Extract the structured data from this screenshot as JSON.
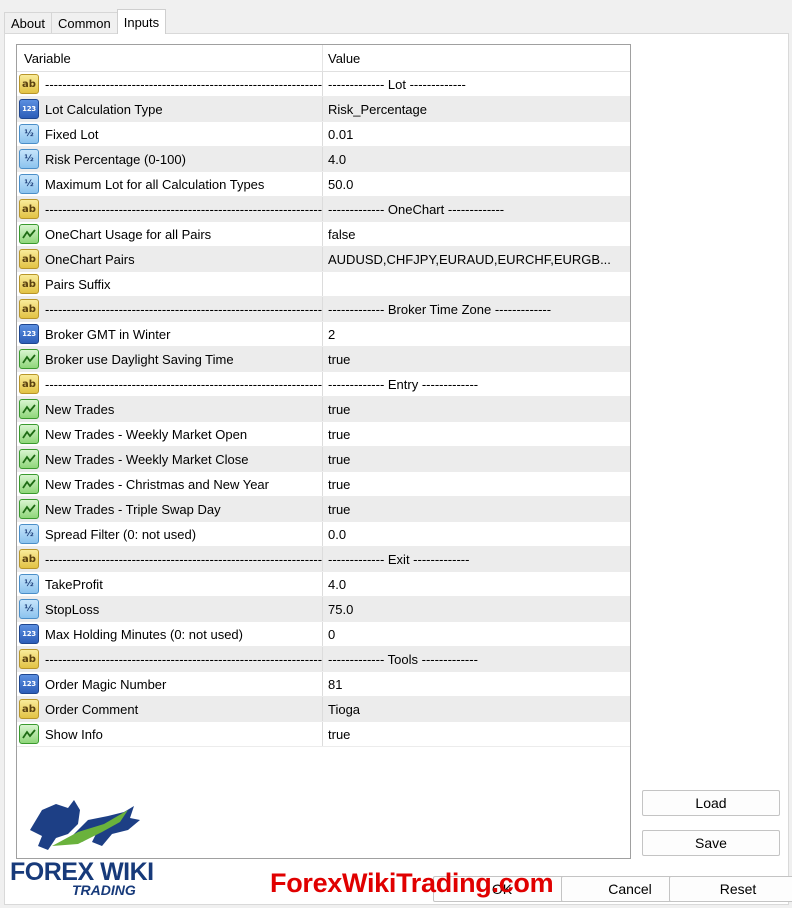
{
  "tabs": [
    {
      "label": "About"
    },
    {
      "label": "Common"
    },
    {
      "label": "Inputs"
    }
  ],
  "grid": {
    "headers": {
      "variable": "Variable",
      "value": "Value"
    },
    "rows": [
      {
        "icon": "ab",
        "variable": "-----------------------------------------------------------------",
        "value": "------------- Lot -------------"
      },
      {
        "icon": "123",
        "variable": "Lot Calculation Type",
        "value": "Risk_Percentage"
      },
      {
        "icon": "half",
        "variable": "Fixed Lot",
        "value": "0.01"
      },
      {
        "icon": "half",
        "variable": "Risk Percentage (0-100)",
        "value": "4.0"
      },
      {
        "icon": "half",
        "variable": "Maximum Lot for all Calculation Types",
        "value": "50.0"
      },
      {
        "icon": "ab",
        "variable": "-----------------------------------------------------------------",
        "value": "------------- OneChart -------------"
      },
      {
        "icon": "bool",
        "variable": "OneChart Usage for all Pairs",
        "value": "false"
      },
      {
        "icon": "ab",
        "variable": "OneChart Pairs",
        "value": "AUDUSD,CHFJPY,EURAUD,EURCHF,EURGB..."
      },
      {
        "icon": "ab",
        "variable": "Pairs Suffix",
        "value": ""
      },
      {
        "icon": "ab",
        "variable": "-----------------------------------------------------------------",
        "value": "------------- Broker Time Zone -------------"
      },
      {
        "icon": "123",
        "variable": "Broker GMT in Winter",
        "value": "2"
      },
      {
        "icon": "bool",
        "variable": "Broker use Daylight Saving Time",
        "value": "true"
      },
      {
        "icon": "ab",
        "variable": "-----------------------------------------------------------------",
        "value": "------------- Entry -------------"
      },
      {
        "icon": "bool",
        "variable": "New Trades",
        "value": "true"
      },
      {
        "icon": "bool",
        "variable": "New Trades - Weekly Market Open",
        "value": "true"
      },
      {
        "icon": "bool",
        "variable": "New Trades - Weekly Market Close",
        "value": "true"
      },
      {
        "icon": "bool",
        "variable": "New Trades - Christmas and New Year",
        "value": "true"
      },
      {
        "icon": "bool",
        "variable": "New Trades - Triple Swap Day",
        "value": "true"
      },
      {
        "icon": "half",
        "variable": "Spread Filter (0: not used)",
        "value": "0.0"
      },
      {
        "icon": "ab",
        "variable": "-----------------------------------------------------------------",
        "value": "------------- Exit -------------"
      },
      {
        "icon": "half",
        "variable": "TakeProfit",
        "value": "4.0"
      },
      {
        "icon": "half",
        "variable": "StopLoss",
        "value": "75.0"
      },
      {
        "icon": "123",
        "variable": "Max Holding Minutes (0: not used)",
        "value": "0"
      },
      {
        "icon": "ab",
        "variable": "-----------------------------------------------------------------",
        "value": "------------- Tools -------------"
      },
      {
        "icon": "123",
        "variable": "Order Magic Number",
        "value": "81"
      },
      {
        "icon": "ab",
        "variable": "Order Comment",
        "value": "Tioga"
      },
      {
        "icon": "bool",
        "variable": "Show Info",
        "value": "true"
      }
    ]
  },
  "buttons": {
    "load": "Load",
    "save": "Save",
    "ok": "OK",
    "cancel": "Cancel",
    "reset": "Reset"
  },
  "branding": {
    "logo_main": "FOREX WIKI",
    "logo_sub": "TRADING",
    "watermark": "ForexWikiTrading.com"
  }
}
